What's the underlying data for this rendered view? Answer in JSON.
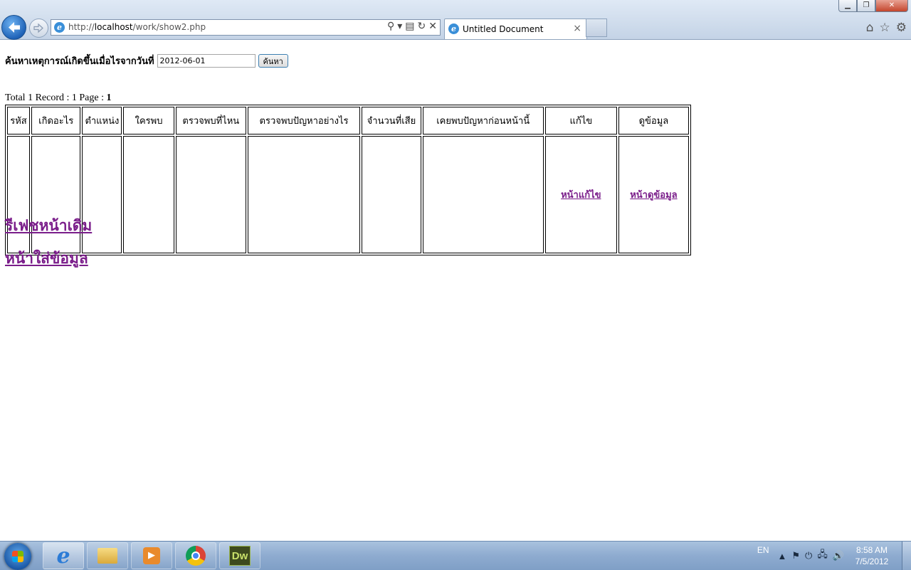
{
  "browser": {
    "url_prefix": "http://",
    "url_host": "localhost",
    "url_path": "/work/show2.php",
    "tab_title": "Untitled Document",
    "tab_close": "×"
  },
  "page": {
    "search_label": "ค้นหาเหตุการณ์เกิดขึ้นเมื่อไรจากวันที่",
    "date_value": "2012-06-01",
    "search_button": "ค้นหา",
    "summary_text": "Total 1 Record : 1 Page : ",
    "summary_page": "1",
    "table": {
      "headers": [
        "รหัส",
        "เกิดอะไร",
        "ตำแหน่ง",
        "ใครพบ",
        "ตรวจพบที่ไหน",
        "ตรวจพบปัญหาอย่างไร",
        "จำนวนที่เสีย",
        "เคยพบปัญหาก่อนหน้านี้",
        "แก้ไข",
        "ดูข้อมูล"
      ],
      "row": {
        "edit_link": "หน้าแก้ไข",
        "view_link": "หน้าดูข้อมูล"
      }
    },
    "link_refresh": "รีเฟชหน้าเดิม",
    "link_insert": "หน้าใส่ข้อมูล"
  },
  "taskbar": {
    "lang": "EN",
    "time": "8:58 AM",
    "date": "7/5/2012",
    "dw_label": "Dw"
  }
}
